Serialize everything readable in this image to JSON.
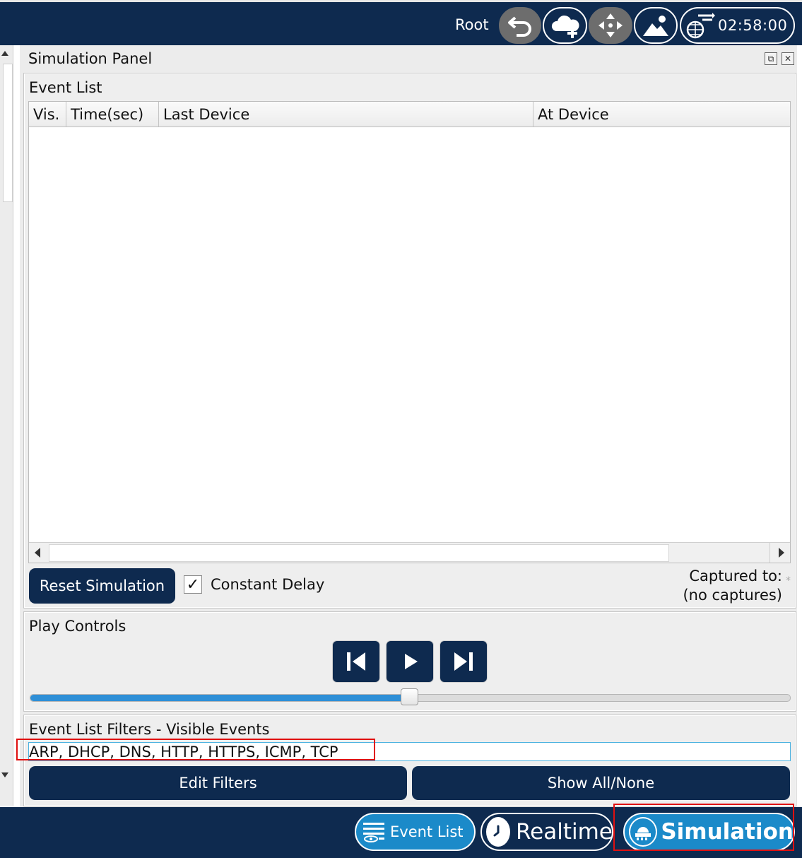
{
  "topbar": {
    "user_label": "Root",
    "clock": "02:58:00",
    "icons": [
      "undo-icon",
      "cloud-add-icon",
      "move-icon",
      "image-icon",
      "network-clock-icon"
    ]
  },
  "panel": {
    "title": "Simulation Panel",
    "window_controls": [
      "restore-icon",
      "close-icon"
    ]
  },
  "event_list": {
    "title": "Event List",
    "columns": [
      "Vis.",
      "Time(sec)",
      "Last Device",
      "At Device"
    ],
    "rows": []
  },
  "controls": {
    "reset_label": "Reset Simulation",
    "constant_delay_label": "Constant Delay",
    "constant_delay_checked": true,
    "captured_label": "Captured to:",
    "captured_value": "(no captures)"
  },
  "play_controls": {
    "title": "Play Controls",
    "buttons": [
      "skip-back-icon",
      "play-icon",
      "skip-forward-icon"
    ],
    "slider_fraction": 0.5
  },
  "filters": {
    "title": "Event List Filters - Visible Events",
    "visible_events": "ARP, DHCP, DNS, HTTP, HTTPS, ICMP, TCP",
    "edit_label": "Edit Filters",
    "show_all_label": "Show All/None"
  },
  "bottombar": {
    "event_list_label": "Event List",
    "realtime_label": "Realtime",
    "simulation_label": "Simulation"
  },
  "colors": {
    "navy": "#0e2a4f",
    "accent_blue": "#1b8ac9",
    "highlight_red": "#e01010"
  }
}
